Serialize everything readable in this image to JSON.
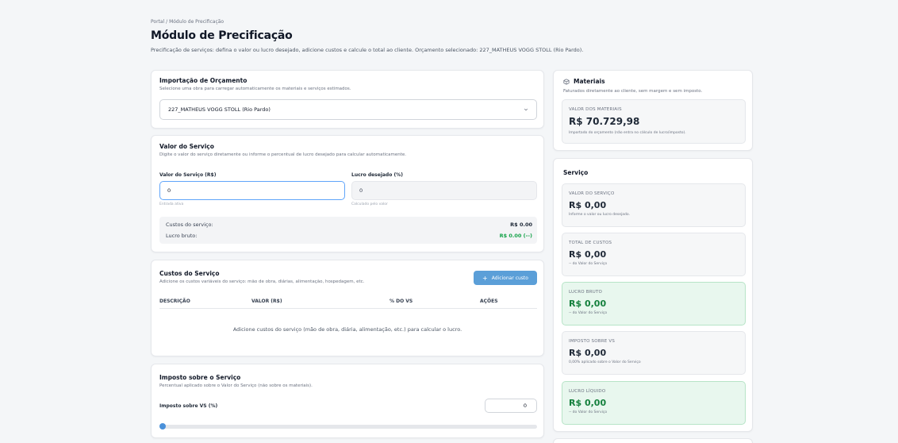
{
  "header": {
    "breadcrumb": "Portal / Módulo de Precificação",
    "title": "Módulo de Precificação",
    "subtitle": "Precificação de serviços: defina o valor ou lucro desejado, adicione custos e calcule o total ao cliente. Orçamento selecionado: 227_MATHEUS VOGG STOLL (Rio Pardo)."
  },
  "importacao": {
    "title": "Importação de Orçamento",
    "subtitle": "Selecione uma obra para carregar automaticamente os materiais e serviços estimados.",
    "selected": "227_MATHEUS VOGG STOLL (Rio Pardo)"
  },
  "valor_servico": {
    "title": "Valor do Serviço",
    "subtitle": "Digite o valor do serviço diretamente ou informe o percentual de lucro desejado para calcular automaticamente.",
    "valor_label": "Valor do Serviço (R$)",
    "valor_value": "0",
    "valor_hint": "Entrada ativa",
    "lucro_label": "Lucro desejado (%)",
    "lucro_value": "0",
    "lucro_hint": "Calculado pelo valor",
    "custos_label": "Custos do serviço:",
    "custos_value": "R$ 0.00",
    "lucro_bruto_label": "Lucro bruto:",
    "lucro_bruto_value": "R$ 0.00 (--)"
  },
  "custos": {
    "title": "Custos do Serviço",
    "subtitle": "Adicione os custos variáveis do serviço: mão de obra, diárias, alimentação, hospedagem, etc.",
    "add_button": "Adicionar custo",
    "columns": [
      "DESCRIÇÃO",
      "VALOR (R$)",
      "% DO VS",
      "AÇÕES"
    ],
    "empty": "Adicione custos do serviço (mão de obra, diária, alimentação, etc.) para calcular o lucro."
  },
  "imposto": {
    "title": "Imposto sobre o Serviço",
    "subtitle": "Percentual aplicado sobre o Valor do Serviço (não sobre os materiais).",
    "label": "Imposto sobre VS (%)",
    "value": "0",
    "slider_fraction": 0
  },
  "materiais": {
    "title": "Materiais",
    "subtitle": "Faturados diretamente ao cliente, sem margem e sem imposto.",
    "metric_label": "VALOR DOS MATERIAIS",
    "metric_value": "R$ 70.729,98",
    "metric_note": "Importado do orçamento (não entra no cálculo de lucro/imposto)."
  },
  "servico": {
    "title": "Serviço",
    "metrics": [
      {
        "label": "VALOR DO SERVIÇO",
        "value": "R$ 0,00",
        "note": "Informe o valor ou lucro desejado."
      },
      {
        "label": "TOTAL DE CUSTOS",
        "value": "R$ 0,00",
        "note": "-- do Valor do Serviço"
      },
      {
        "label": "LUCRO BRUTO",
        "value": "R$ 0,00",
        "note": "-- do Valor do Serviço"
      },
      {
        "label": "IMPOSTO SOBRE VS",
        "value": "R$ 0,00",
        "note": "0,00% aplicado sobre o Valor do Serviço"
      },
      {
        "label": "LUCRO LÍQUIDO",
        "value": "R$ 0,00",
        "note": "-- do Valor do Serviço"
      }
    ]
  },
  "colors": {
    "accent": "#5b9fd8",
    "positive": "#16a34a",
    "positive_bg": "#e8f7ee"
  }
}
